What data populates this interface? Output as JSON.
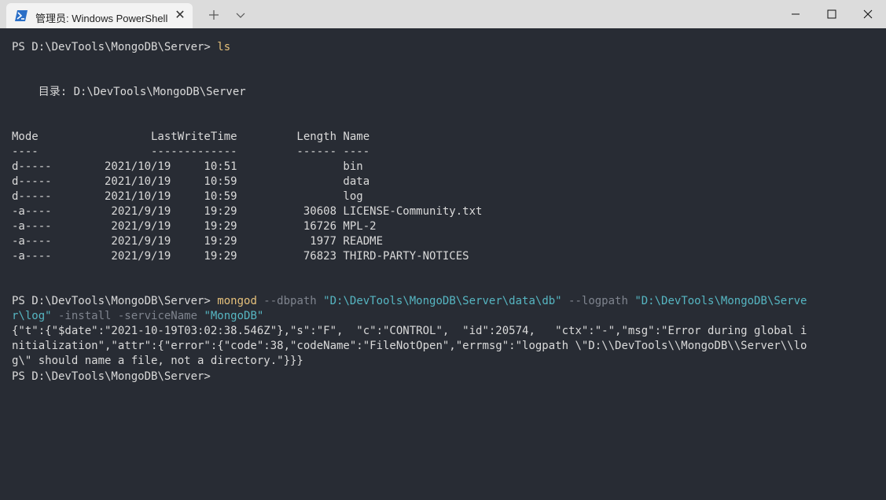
{
  "window": {
    "tab_title": "管理员: Windows PowerShell",
    "tab_icon": "powershell-icon",
    "close_tab_glyph": "✕",
    "new_tab_glyph": "+",
    "dropdown_glyph": "⌄"
  },
  "terminal": {
    "prompt": "PS D:\\DevTools\\MongoDB\\Server> ",
    "cmd1": "ls",
    "directory_label": "    目录: D:\\DevTools\\MongoDB\\Server",
    "listing_header": "Mode                 LastWriteTime         Length Name",
    "listing_rule": "----                 -------------         ------ ----",
    "listing": [
      "d-----        2021/10/19     10:51                bin",
      "d-----        2021/10/19     10:59                data",
      "d-----        2021/10/19     10:59                log",
      "-a----         2021/9/19     19:29          30608 LICENSE-Community.txt",
      "-a----         2021/9/19     19:29          16726 MPL-2",
      "-a----         2021/9/19     19:29           1977 README",
      "-a----         2021/9/19     19:29          76823 THIRD-PARTY-NOTICES"
    ],
    "cmd2": {
      "exe": "mongod",
      "flag_dbpath": " --dbpath ",
      "dbpath": "\"D:\\DevTools\\MongoDB\\Server\\data\\db\"",
      "flag_logpath": " --logpath ",
      "logpath_part1": "\"D:\\DevTools\\MongoDB\\Serve",
      "logpath_part2": "r\\log\"",
      "flag_install": " -install -serviceName ",
      "service_name": "\"MongoDB\""
    },
    "error_output": [
      "{\"t\":{\"$date\":\"2021-10-19T03:02:38.546Z\"},\"s\":\"F\",  \"c\":\"CONTROL\",  \"id\":20574,   \"ctx\":\"-\",\"msg\":\"Error during global i",
      "nitialization\",\"attr\":{\"error\":{\"code\":38,\"codeName\":\"FileNotOpen\",\"errmsg\":\"logpath \\\"D:\\\\DevTools\\\\MongoDB\\\\Server\\\\lo",
      "g\\\" should name a file, not a directory.\"}}}"
    ]
  },
  "colors": {
    "background": "#282c34",
    "foreground": "#dadada",
    "command": "#e5c07b",
    "parameter": "#7f848e",
    "string": "#56b6c2"
  }
}
